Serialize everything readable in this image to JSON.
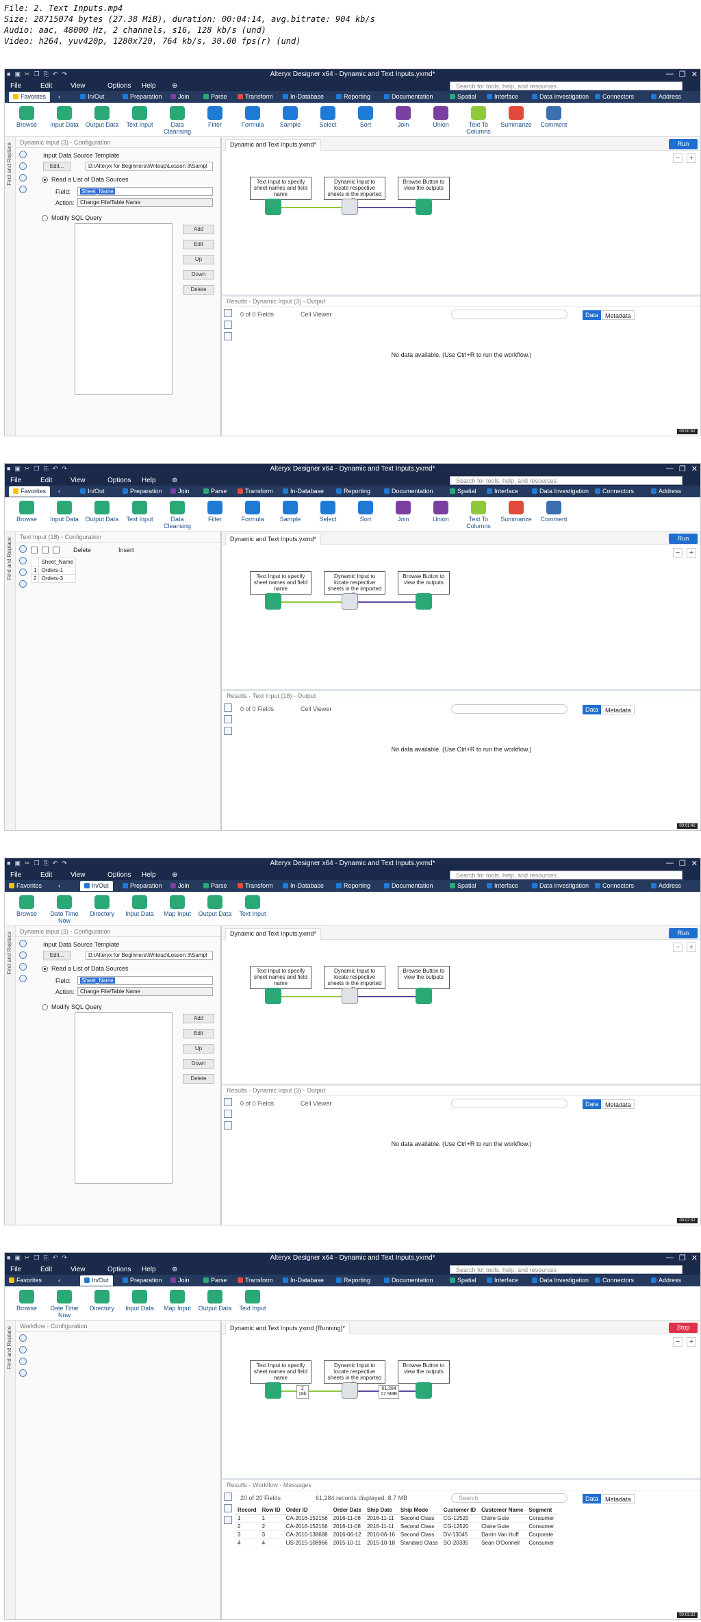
{
  "meta": {
    "line1": "File: 2. Text Inputs.mp4",
    "line2": "Size: 28715074 bytes (27.38 MiB), duration: 00:04:14, avg.bitrate: 904 kb/s",
    "line3": "Audio: aac, 48000 Hz, 2 channels, s16, 128 kb/s (und)",
    "line4": "Video: h264, yuv420p, 1280x720, 764 kb/s, 30.00 fps(r) (und)"
  },
  "app": {
    "title": "Alteryx Designer x64 - Dynamic and Text Inputs.yxmd*",
    "menu": [
      "File",
      "Edit",
      "View",
      "Options",
      "Help"
    ],
    "search_placeholder": "Search for tools, help, and resources",
    "categories": [
      "Favorites",
      "In/Out",
      "Preparation",
      "Join",
      "Parse",
      "Transform",
      "In-Database",
      "Reporting",
      "Documentation",
      "Spatial",
      "Interface",
      "Data Investigation",
      "Connectors",
      "Address"
    ],
    "colors": {
      "titlebar": "#1b2a4a",
      "accent": "#1f6fd0",
      "green": "#2aa876",
      "stop": "#e0324a"
    }
  },
  "fav_tools": [
    "Browse",
    "Input Data",
    "Output Data",
    "Text Input",
    "Data Cleansing",
    "Filter",
    "Formula",
    "Sample",
    "Select",
    "Sort",
    "Join",
    "Union",
    "Text To Columns",
    "Summarize",
    "Comment"
  ],
  "inout_tools": [
    "Browse",
    "Date Time Now",
    "Directory",
    "Input Data",
    "Map Input",
    "Output Data",
    "Text Input"
  ],
  "canvas": {
    "tab": "Dynamic and Text Inputs.yxmd*",
    "tab_running": "Dynamic and Text Inputs.yxmd (Running)*",
    "note1": "Text Input to specify sheet names and field name",
    "note2": "Dynamic Input to locate respective sheets in the imported file",
    "note3": "Browse Button to view the outputs",
    "run": "Run",
    "stop": "Stop",
    "badge_left": "2\n18b",
    "badge_right": "61,284\n17.9MB"
  },
  "frame1": {
    "cfg_title": "Dynamic Input (3) - Configuration",
    "template_label": "Input Data Source Template",
    "edit_btn": "Edit...",
    "path": "D:\\Alteryx for Beginners\\Writeup\\Lesson 3\\Sampl",
    "radio1": "Read a List of Data Sources",
    "field_label": "Field:",
    "field_value": "Sheet_Name",
    "action_label": "Action:",
    "action_value": "Change File/Table Name",
    "radio2": "Modify SQL Query",
    "side_btns": [
      "Add",
      "Edit",
      "Up",
      "Down",
      "Delete"
    ],
    "results_title": "Results - Dynamic Input (3) - Output",
    "fields": "0 of 0 Fields",
    "cell_viewer": "Cell Viewer",
    "data_tab": "Data",
    "metadata_tab": "Metadata",
    "empty_msg": "No data available. (Use Ctrl+R to run the workflow.)",
    "timestamp": "00:00:52"
  },
  "frame2": {
    "cfg_title": "Text Input (18) - Configuration",
    "delete_btn": "Delete",
    "insert_btn": "Insert",
    "col_header": "Sheet_Name",
    "rows": [
      {
        "n": "1",
        "v": "Orders-1"
      },
      {
        "n": "2",
        "v": "Orders-3"
      }
    ],
    "results_title": "Results - Text Input (18) - Output",
    "timestamp": "00:01:42"
  },
  "frame3": {
    "cfg_title": "Dynamic Input (3) - Configuration",
    "results_title": "Results - Dynamic Input (3) - Output",
    "timestamp": "00:02:32"
  },
  "frame4": {
    "cfg_title": "Workflow - Configuration",
    "results_title": "Results - Workflow - Messages",
    "fields": "20 of 20 Fields",
    "records": "61,284 records displayed, 8.7 MB",
    "search": "Search",
    "timestamp": "00:03:22",
    "table": {
      "headers": [
        "Record",
        "Row ID",
        "Order ID",
        "Order Date",
        "Ship Date",
        "Ship Mode",
        "Customer ID",
        "Customer Name",
        "Segment"
      ],
      "rows": [
        [
          "1",
          "1",
          "CA-2016-152156",
          "2016-11-08",
          "2016-11-11",
          "Second Class",
          "CG-12520",
          "Claire Gute",
          "Consumer"
        ],
        [
          "2",
          "2",
          "CA-2016-152156",
          "2016-11-08",
          "2016-11-11",
          "Second Class",
          "CG-12520",
          "Claire Gute",
          "Consumer"
        ],
        [
          "3",
          "3",
          "CA-2016-138688",
          "2016-06-12",
          "2016-06-16",
          "Second Class",
          "DV-13045",
          "Darrin Van Huff",
          "Corporate"
        ],
        [
          "4",
          "4",
          "US-2015-108966",
          "2015-10-11",
          "2015-10-18",
          "Standard Class",
          "SO-20335",
          "Sean O'Donnell",
          "Consumer"
        ]
      ]
    }
  }
}
